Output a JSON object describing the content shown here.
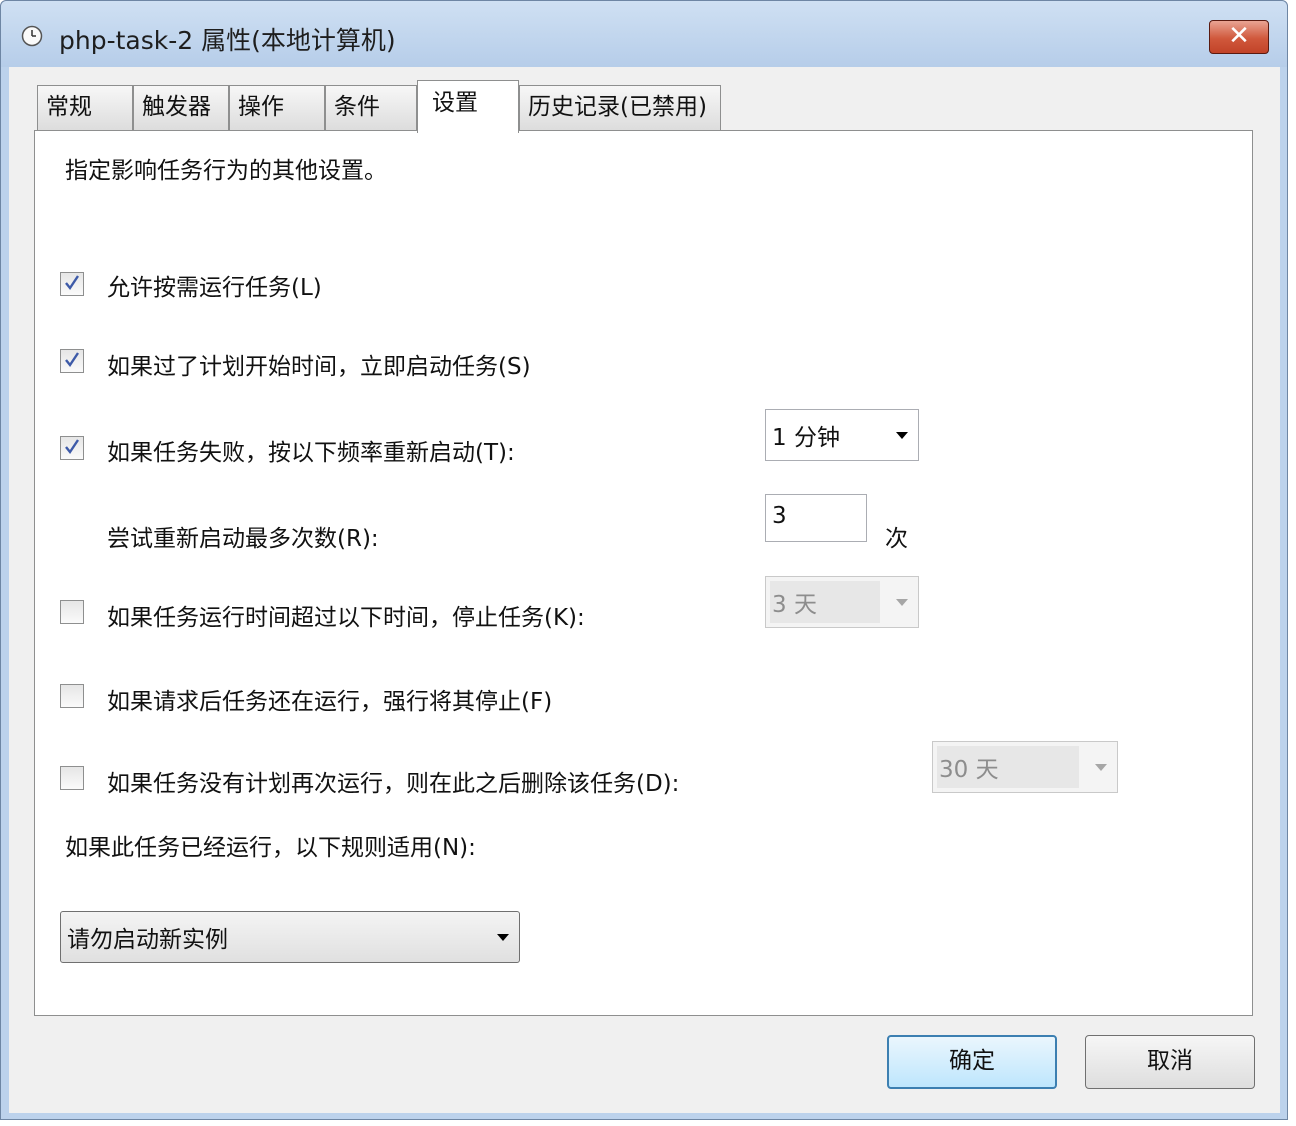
{
  "window": {
    "title": "php-task-2 属性(本地计算机)",
    "close_label": "✕"
  },
  "tabs": [
    {
      "label": "常规"
    },
    {
      "label": "触发器"
    },
    {
      "label": "操作"
    },
    {
      "label": "条件"
    },
    {
      "label": "设置"
    },
    {
      "label": "历史记录(已禁用)"
    }
  ],
  "active_tab": "设置",
  "settings": {
    "description": "指定影响任务行为的其他设置。",
    "allow_on_demand": {
      "label": "允许按需运行任务(L)",
      "checked": true
    },
    "run_asap_missed": {
      "label": "如果过了计划开始时间，立即启动任务(S)",
      "checked": true
    },
    "restart_on_fail": {
      "label": "如果任务失败，按以下频率重新启动(T):",
      "checked": true,
      "interval": "1 分钟"
    },
    "restart_attempts": {
      "label": "尝试重新启动最多次数(R):",
      "value": "3",
      "unit": "次"
    },
    "stop_if_runs_longer": {
      "label": "如果任务运行时间超过以下时间，停止任务(K):",
      "checked": false,
      "value": "3 天"
    },
    "force_stop": {
      "label": "如果请求后任务还在运行，强行将其停止(F)",
      "checked": false
    },
    "delete_if_not_scheduled": {
      "label": "如果任务没有计划再次运行，则在此之后删除该任务(D):",
      "checked": false,
      "value": "30 天"
    },
    "running_rule": {
      "label": "如果此任务已经运行，以下规则适用(N):",
      "value": "请勿启动新实例"
    }
  },
  "buttons": {
    "ok": "确定",
    "cancel": "取消"
  }
}
